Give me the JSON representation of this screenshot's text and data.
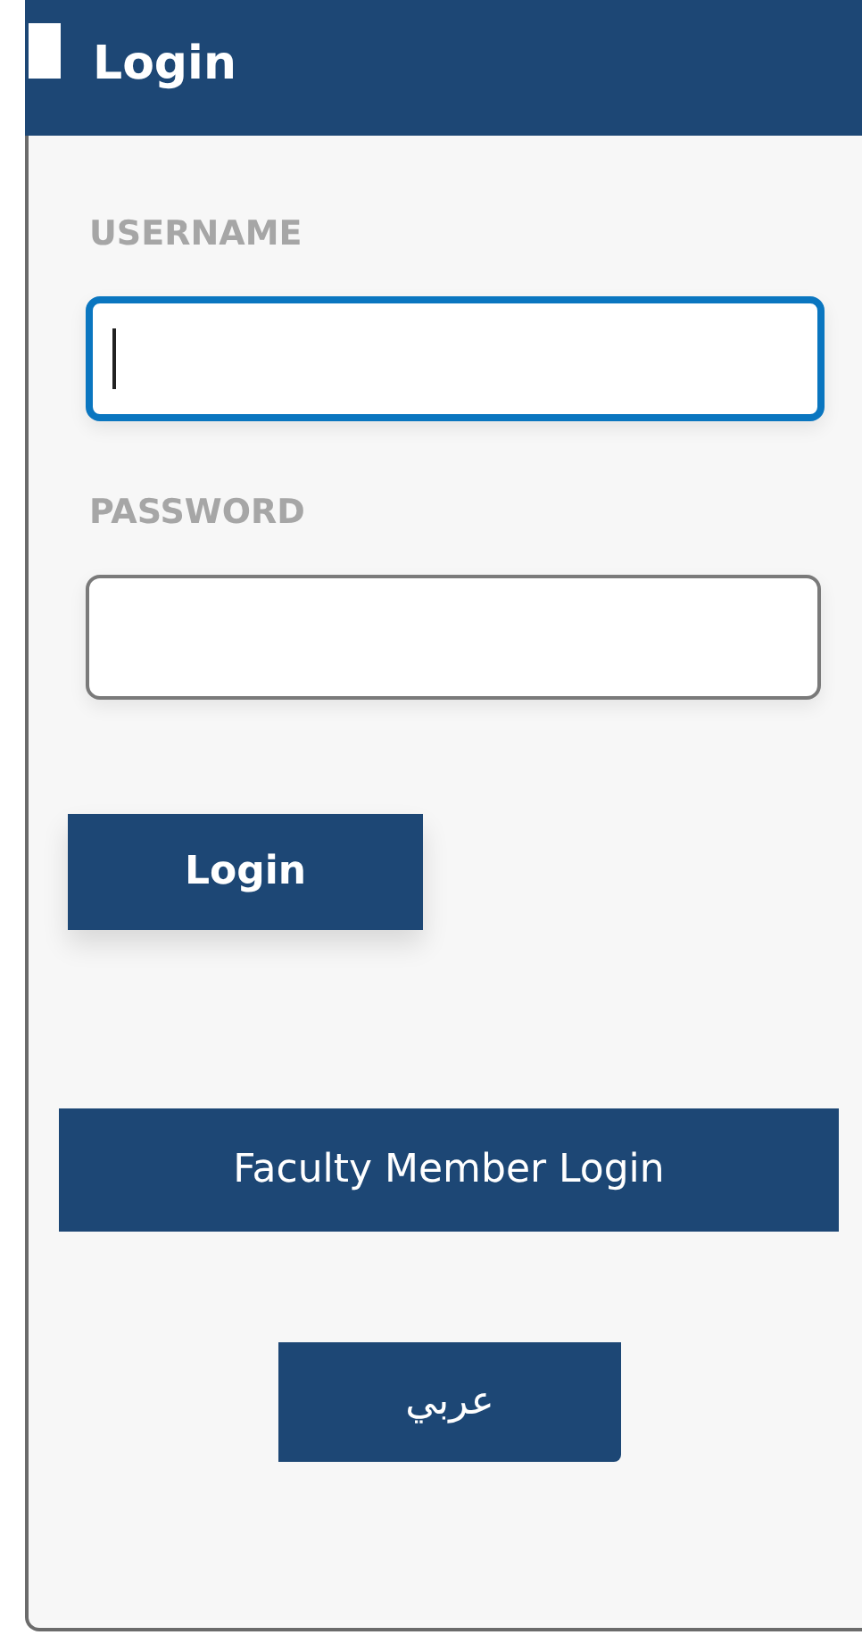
{
  "header": {
    "title": "Login"
  },
  "fields": [
    {
      "label": "USERNAME",
      "focused": true
    },
    {
      "label": "PASSWORD",
      "focused": false
    }
  ],
  "buttons": [
    {
      "kind": "submit",
      "label": "Login"
    },
    {
      "kind": "wide",
      "label": "Faculty Member Login"
    },
    {
      "kind": "language",
      "label": "عربي"
    }
  ]
}
